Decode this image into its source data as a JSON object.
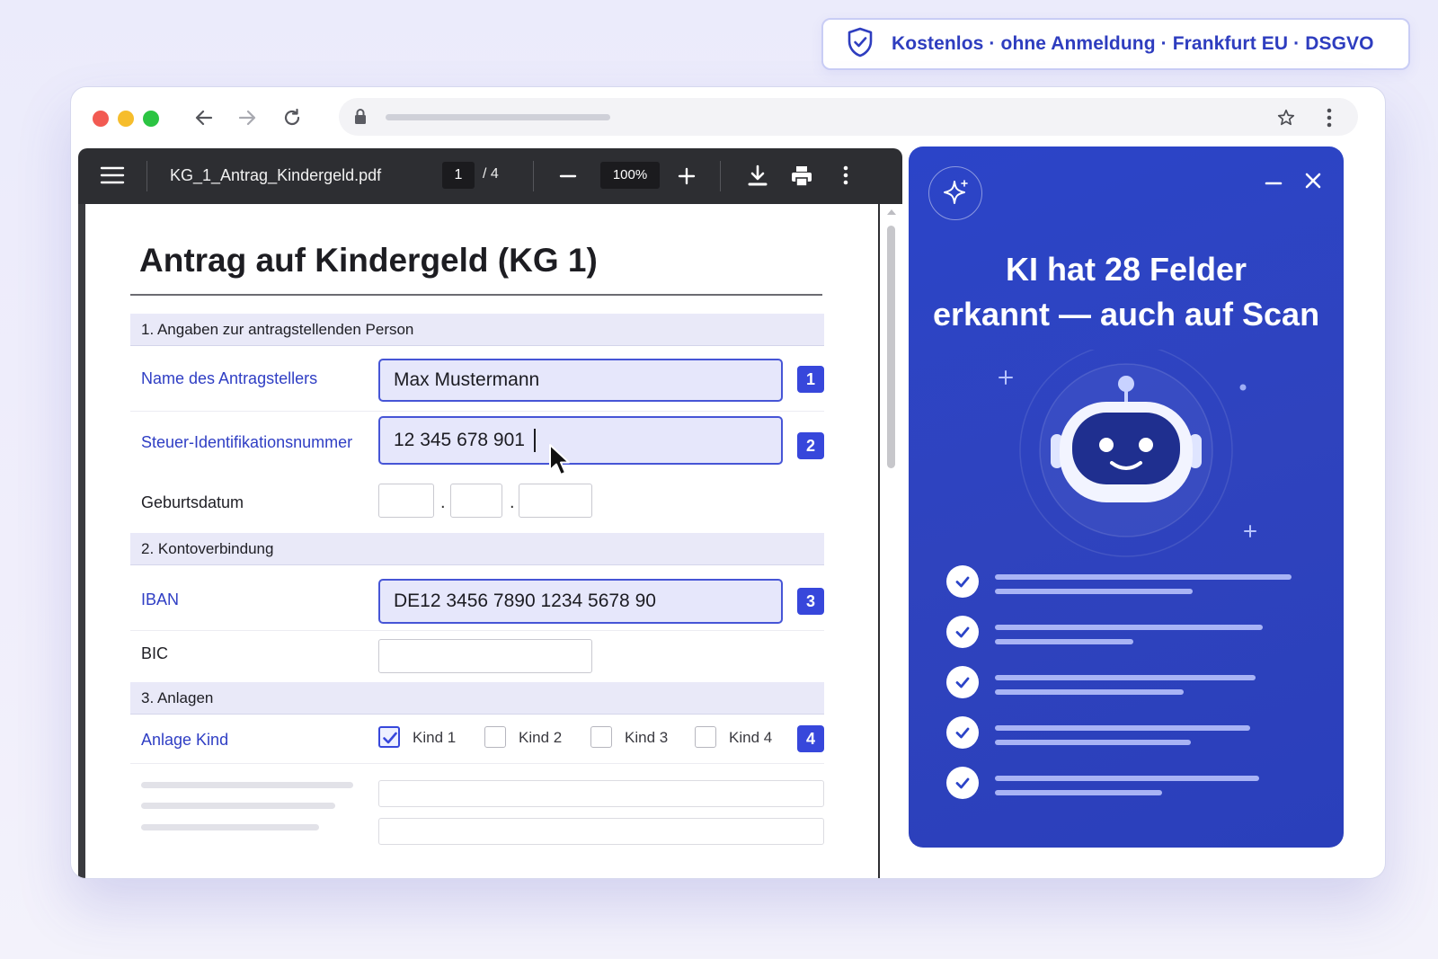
{
  "badge": {
    "icon": "shield-check-icon",
    "items": [
      "Kostenlos",
      "ohne Anmeldung",
      "Frankfurt EU",
      "DSGVO"
    ],
    "separator": "·"
  },
  "browser": {
    "traffic_lights": [
      "#f25a52",
      "#f6bd2c",
      "#2bc442"
    ],
    "nav_icons": [
      "back-arrow-icon",
      "forward-arrow-icon",
      "reload-icon"
    ],
    "url_icons": [
      "lock-icon",
      "star-icon",
      "kebab-menu-icon"
    ]
  },
  "pdf_viewer": {
    "filename": "KG_1_Antrag_Kindergeld.pdf",
    "current_page": "1",
    "total_pages": "/ 4",
    "zoom": "100%",
    "icons": [
      "hamburger-menu-icon",
      "zoom-out-icon",
      "zoom-in-icon",
      "download-icon",
      "print-icon",
      "more-vert-icon"
    ]
  },
  "document": {
    "title": "Antrag auf Kindergeld (KG 1)",
    "sections": [
      {
        "label": "1. Angaben zur antragstellenden Person"
      },
      {
        "label": "2.  Kontoverbindung"
      },
      {
        "label": "3.  Anlagen"
      }
    ],
    "fields": {
      "name": {
        "label": "Name des Antragstellers",
        "value": "Max Mustermann",
        "tag": "1"
      },
      "steuer": {
        "label": "Steuer-Identifikationsnummer",
        "value": "12 345 678 901",
        "tag": "2"
      },
      "geburt": {
        "label": "Geburtsdatum",
        "separator": "."
      },
      "iban": {
        "label": "IBAN",
        "value": "DE12 3456 7890 1234 5678 90",
        "tag": "3"
      },
      "bic": {
        "label": "BIC"
      },
      "anlage": {
        "label": "Anlage Kind",
        "tag": "4",
        "options": [
          {
            "label": "Kind 1",
            "checked": true
          },
          {
            "label": "Kind 2",
            "checked": false
          },
          {
            "label": "Kind 3",
            "checked": false
          },
          {
            "label": "Kind 4",
            "checked": false
          }
        ]
      }
    }
  },
  "ai_panel": {
    "title_line1": "KI hat 28 Felder",
    "title_line2": "erkannt — auch auf Scan",
    "icons": [
      "sparkle-icon",
      "minimize-icon",
      "close-icon",
      "robot-icon",
      "check-icon"
    ],
    "accent": "#2b44c8"
  }
}
